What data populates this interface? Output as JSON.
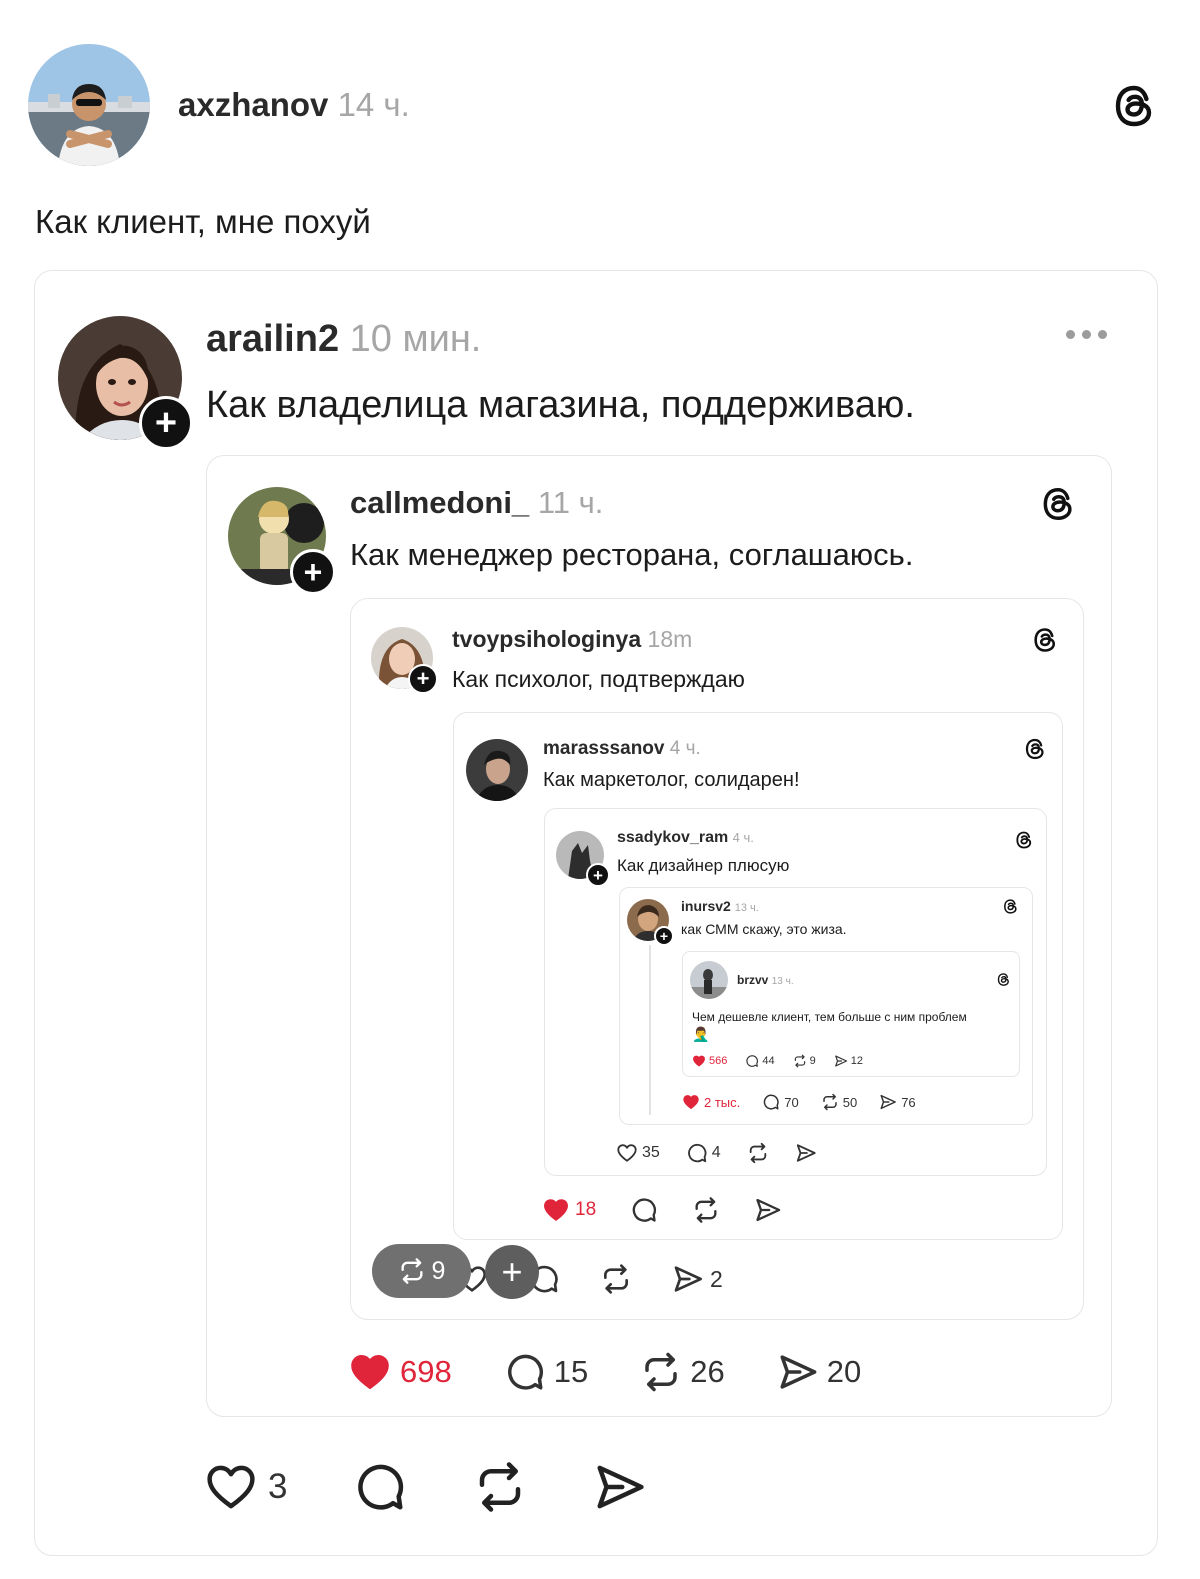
{
  "post": {
    "username": "axzhanov",
    "time": "14 ч.",
    "text": "Как клиент, мне похуй",
    "actions": {
      "likes": "3"
    }
  },
  "quote1": {
    "username": "arailin2",
    "time": "10 мин.",
    "text": "Как владелица магазина, поддерживаю.",
    "actions": {
      "likes": "698",
      "comments": "15",
      "reposts": "26",
      "shares": "20"
    }
  },
  "quote2": {
    "username": "callmedoni_",
    "time": "11 ч.",
    "text": "Как менеджер ресторана, соглашаюсь.",
    "overlay_repost_count": "9",
    "actions": {
      "shares": "2"
    }
  },
  "quote3": {
    "username": "tvoypsihologinya",
    "time": "18m",
    "text": "Как психолог, подтверждаю",
    "actions": {
      "likes": "18"
    }
  },
  "quote4": {
    "username": "marasssanov",
    "time": "4 ч.",
    "text": "Как маркетолог, солидарен!",
    "actions": {
      "likes": "35",
      "comments": "4"
    }
  },
  "quote5": {
    "username": "ssadykov_ram",
    "time": "4 ч.",
    "text": "Как дизайнер плюсую",
    "actions": {
      "likes": "2 тыс.",
      "comments": "70",
      "reposts": "50",
      "shares": "76"
    }
  },
  "quote6": {
    "username": "inursv2",
    "time": "13 ч.",
    "text": "как СММ скажу, это жиза.",
    "actions": {
      "likes": "566",
      "comments": "44",
      "reposts": "9",
      "shares": "12"
    }
  },
  "quote7": {
    "username": "brzvv",
    "time": "13 ч.",
    "text": "Чем дешевле клиент, тем больше с ним проблем",
    "emoji": "🤦‍♂️"
  },
  "colors": {
    "like_red": "#e0243a",
    "muted_gray": "#a6a6a6",
    "border": "#e6e6e6"
  }
}
